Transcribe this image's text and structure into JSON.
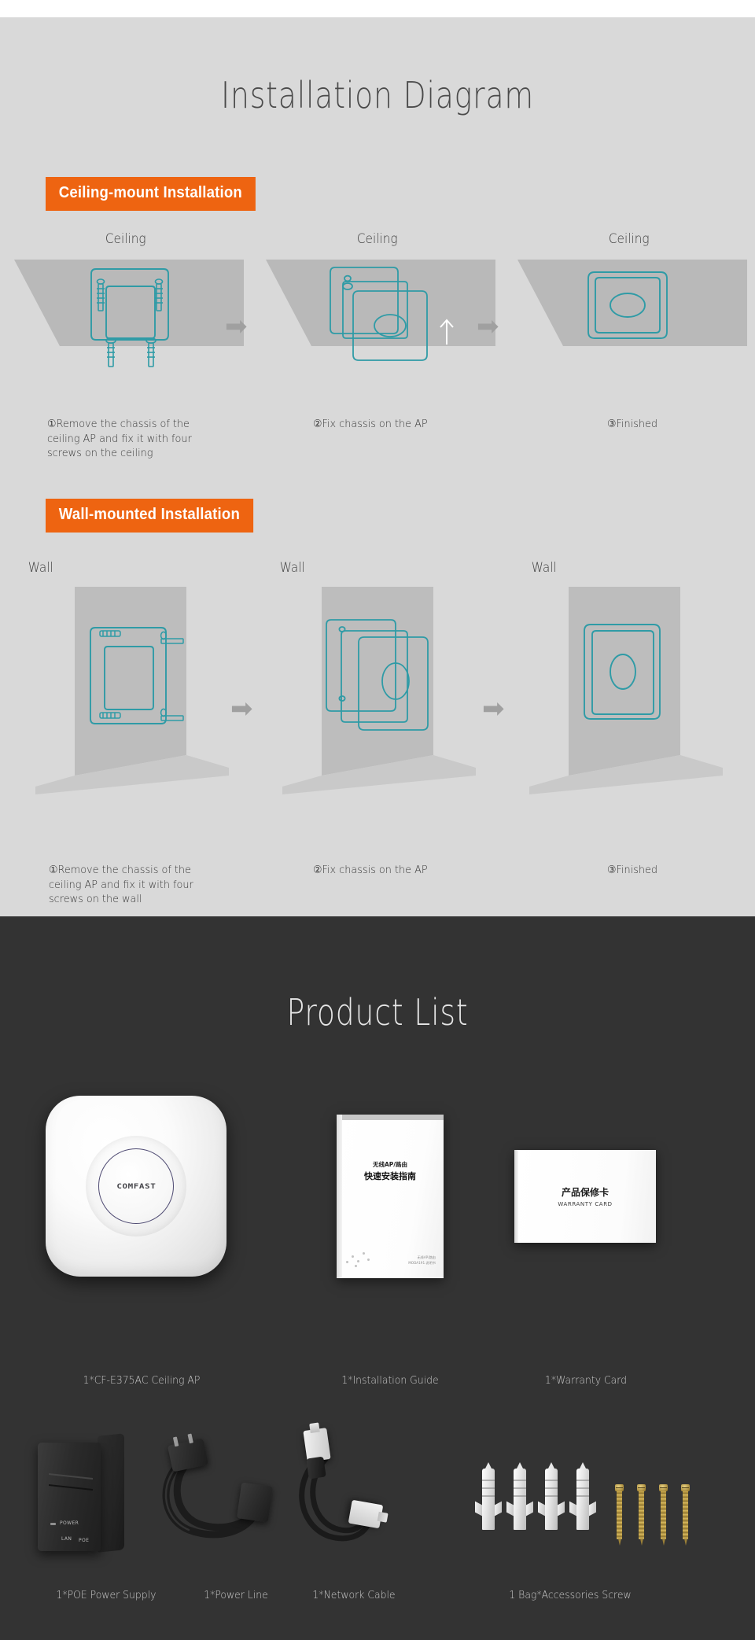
{
  "install": {
    "title": "Installation Diagram",
    "ceiling_banner": "Ceiling-mount Installation",
    "wall_banner": "Wall-mounted Installation",
    "ceiling_steps": [
      {
        "head": "Ceiling",
        "caption": "①Remove the chassis of the ceiling AP and fix it with four screws on the ceiling"
      },
      {
        "head": "Ceiling",
        "caption": "②Fix chassis on the AP"
      },
      {
        "head": "Ceiling",
        "caption": "③Finished"
      }
    ],
    "wall_steps": [
      {
        "head": "Wall",
        "caption": "①Remove the chassis of the ceiling AP and fix it with four screws on the wall"
      },
      {
        "head": "Wall",
        "caption": "②Fix chassis on the AP"
      },
      {
        "head": "Wall",
        "caption": "③Finished"
      }
    ]
  },
  "product": {
    "title": "Product List",
    "ap_logo": "COMFAST",
    "booklet": {
      "subtitle_cn": "无线AP/路由",
      "title_cn": "快速安装指南",
      "footer_cn": "无线AP/路由",
      "footer_code": "MODA191.说明书"
    },
    "warranty": {
      "title_cn": "产品保修卡",
      "title_en": "WARRANTY CARD"
    },
    "poe": {
      "power_label": "POWER",
      "lan_label": "LAN",
      "poe_label": "POE"
    },
    "items_row1": [
      "1*CF-E375AC Ceiling AP",
      "1*Installation Guide",
      "1*Warranty Card"
    ],
    "items_row2": [
      "1*POE Power Supply",
      "1*Power Line",
      "1*Network Cable",
      "1 Bag*Accessories Screw"
    ]
  },
  "colors": {
    "accent_orange": "#ee6411",
    "diagram_teal": "#2f9ba6",
    "light_bg": "#d9d9d9",
    "dark_bg": "#333333"
  }
}
